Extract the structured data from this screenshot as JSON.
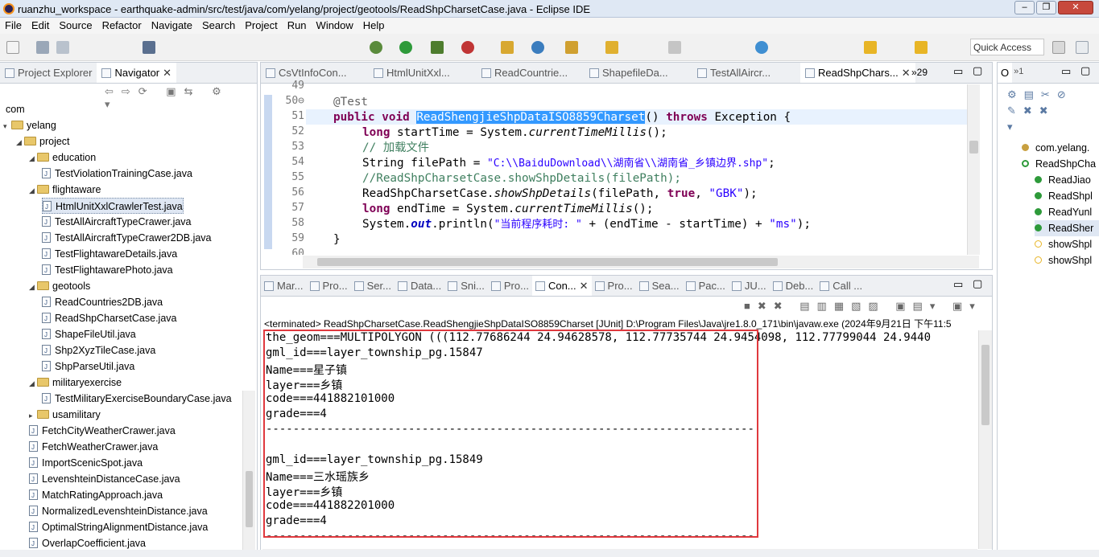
{
  "window": {
    "title": "ruanzhu_workspace - earthquake-admin/src/test/java/com/yelang/project/geotools/ReadShpCharsetCase.java - Eclipse IDE",
    "min": "‒",
    "max": "❐",
    "close": "✕"
  },
  "menu": [
    "File",
    "Edit",
    "Source",
    "Refactor",
    "Navigate",
    "Search",
    "Project",
    "Run",
    "Window",
    "Help"
  ],
  "quick_access": "Quick Access",
  "left_tabs": {
    "project_explorer": "Project Explorer",
    "navigator": "Navigator"
  },
  "navigator_tree": [
    {
      "label": "com",
      "kind": "text",
      "level": 0
    },
    {
      "label": "yelang",
      "kind": "folder",
      "level": 0,
      "tw": "▾"
    },
    {
      "label": "project",
      "kind": "folder",
      "level": 1,
      "tw": "◢"
    },
    {
      "label": "education",
      "kind": "folder",
      "level": 2,
      "tw": "◢"
    },
    {
      "label": "TestViolationTrainingCase.java",
      "kind": "java",
      "level": 3
    },
    {
      "label": "flightaware",
      "kind": "folder",
      "level": 2,
      "tw": "◢"
    },
    {
      "label": "HtmlUnitXxlCrawlerTest.java",
      "kind": "java",
      "level": 3,
      "selected": true
    },
    {
      "label": "TestAllAircraftTypeCrawer.java",
      "kind": "java",
      "level": 3
    },
    {
      "label": "TestAllAircraftTypeCrawer2DB.java",
      "kind": "java",
      "level": 3
    },
    {
      "label": "TestFlightawareDetails.java",
      "kind": "java",
      "level": 3
    },
    {
      "label": "TestFlightawarePhoto.java",
      "kind": "java",
      "level": 3
    },
    {
      "label": "geotools",
      "kind": "folder",
      "level": 2,
      "tw": "◢"
    },
    {
      "label": "ReadCountries2DB.java",
      "kind": "java",
      "level": 3
    },
    {
      "label": "ReadShpCharsetCase.java",
      "kind": "java",
      "level": 3
    },
    {
      "label": "ShapeFileUtil.java",
      "kind": "java",
      "level": 3
    },
    {
      "label": "Shp2XyzTileCase.java",
      "kind": "java",
      "level": 3
    },
    {
      "label": "ShpParseUtil.java",
      "kind": "java",
      "level": 3
    },
    {
      "label": "militaryexercise",
      "kind": "folder",
      "level": 2,
      "tw": "◢"
    },
    {
      "label": "TestMilitaryExerciseBoundaryCase.java",
      "kind": "java",
      "level": 3
    },
    {
      "label": "usamilitary",
      "kind": "folder",
      "level": 2,
      "tw": "▸"
    },
    {
      "label": "FetchCityWeatherCrawer.java",
      "kind": "java",
      "level": 2
    },
    {
      "label": "FetchWeatherCrawer.java",
      "kind": "java",
      "level": 2
    },
    {
      "label": "ImportScenicSpot.java",
      "kind": "java",
      "level": 2
    },
    {
      "label": "LevenshteinDistanceCase.java",
      "kind": "java",
      "level": 2
    },
    {
      "label": "MatchRatingApproach.java",
      "kind": "java",
      "level": 2
    },
    {
      "label": "NormalizedLevenshteinDistance.java",
      "kind": "java",
      "level": 2
    },
    {
      "label": "OptimalStringAlignmentDistance.java",
      "kind": "java",
      "level": 2
    },
    {
      "label": "OverlapCoefficient.java",
      "kind": "java",
      "level": 2
    }
  ],
  "editor_tabs": [
    {
      "label": "CsVtInfoCon...",
      "active": false
    },
    {
      "label": "HtmlUnitXxl...",
      "active": false
    },
    {
      "label": "ReadCountrie...",
      "active": false
    },
    {
      "label": "ShapefileDa...",
      "active": false
    },
    {
      "label": "TestAllAircr...",
      "active": false
    },
    {
      "label": "ReadShpChars...",
      "active": true
    }
  ],
  "editor_overflow": "»29",
  "code": {
    "line_numbers": [
      "49",
      "50⊖",
      "51",
      "52",
      "53",
      "54",
      "55",
      "56",
      "57",
      "58",
      "59",
      "60"
    ],
    "l50": "@Test",
    "l51_kw1": "public",
    "l51_kw2": "void",
    "l51_name": "ReadShengjieShpDataISO8859Charset",
    "l51_rest": "() ",
    "l51_throws": "throws",
    "l51_exc": " Exception {",
    "l52_kw": "long",
    "l52_a": " startTime = System.",
    "l52_m": "currentTimeMillis",
    "l52_b": "();",
    "l53": "// 加载文件",
    "l54_a": "String filePath = ",
    "l54_s": "\"C:\\\\BaiduDownload\\\\湖南省\\\\湖南省_乡镇边界.shp\"",
    "l54_b": ";",
    "l55": "//ReadShpCharsetCase.showShpDetails(filePath);",
    "l56_a": "ReadShpCharsetCase.",
    "l56_m": "showShpDetails",
    "l56_b": "(filePath, ",
    "l56_t": "true",
    "l56_c": ", ",
    "l56_s": "\"GBK\"",
    "l56_d": ");",
    "l57_kw": "long",
    "l57_a": " endTime = System.",
    "l57_m": "currentTimeMillis",
    "l57_b": "();",
    "l58_a": "System.",
    "l58_out": "out",
    "l58_b": ".println(",
    "l58_s1": "\"当前程序耗时: \"",
    "l58_c": " + (endTime - startTime) + ",
    "l58_s2": "\"ms\"",
    "l58_d": ");",
    "l59": "}"
  },
  "bottom_tabs": [
    "Mar...",
    "Pro...",
    "Ser...",
    "Data...",
    "Sni...",
    "Pro...",
    "Con...",
    "Pro...",
    "Sea...",
    "Pac...",
    "JU...",
    "Deb...",
    "Call ..."
  ],
  "console": {
    "header": "<terminated> ReadShpCharsetCase.ReadShengjieShpDataISO8859Charset [JUnit] D:\\Program Files\\Java\\jre1.8.0_171\\bin\\javaw.exe (2024年9月21日 下午11:5",
    "lines": [
      "the_geom===MULTIPOLYGON (((112.77686244 24.94628578, 112.77735744 24.9454098, 112.77799044 24.9440",
      "gml_id===layer_township_pg.15847",
      "Name===星子镇",
      "layer===乡镇",
      "code===441882101000",
      "grade===4",
      "------------------------------------------------------------------------",
      "",
      "gml_id===layer_township_pg.15849",
      "Name===三水瑶族乡",
      "layer===乡镇",
      "code===441882201000",
      "grade===4",
      "------------------------------------------------------------------------"
    ]
  },
  "outline": {
    "tab": "O",
    "overflow": "»1",
    "items": [
      {
        "label": "com.yelang.",
        "kind": "pkg",
        "level": 0
      },
      {
        "label": "ReadShpCha",
        "kind": "class",
        "level": 0
      },
      {
        "label": "ReadJiao",
        "kind": "pub",
        "level": 1
      },
      {
        "label": "ReadShpl",
        "kind": "pub",
        "level": 1
      },
      {
        "label": "ReadYunl",
        "kind": "pub",
        "level": 1
      },
      {
        "label": "ReadSher",
        "kind": "pub",
        "level": 1,
        "selected": true
      },
      {
        "label": "showShpl",
        "kind": "static",
        "level": 1
      },
      {
        "label": "showShpl",
        "kind": "static",
        "level": 1
      }
    ]
  },
  "colors": {
    "highlight_box": "#e0393e",
    "selection": "#3399ff",
    "keyword": "#7f0055",
    "string": "#2a00ff",
    "comment": "#3f7f5f"
  }
}
